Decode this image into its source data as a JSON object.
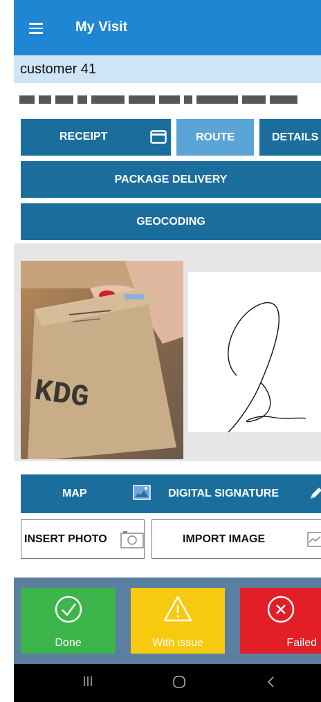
{
  "app": {
    "title": "My Visit"
  },
  "customer": {
    "name": "customer 41"
  },
  "buttons": {
    "receipt": "RECEIPT",
    "route": "ROUTE",
    "details": "DETAILS",
    "package_delivery": "PACKAGE DELIVERY",
    "geocoding": "GEOCODING",
    "map": "MAP",
    "digital_signature": "DIGITAL SIGNATURE",
    "insert_photo": "INSERT PHOTO",
    "import_image": "IMPORT IMAGE"
  },
  "photo": {
    "box_text": "KDG"
  },
  "actions": {
    "done": {
      "label": "Done",
      "color": "#3cb54a"
    },
    "issue": {
      "label": "With issue",
      "color": "#f7c90f"
    },
    "failed": {
      "label": "Failed",
      "color": "#e21e26"
    }
  },
  "colors": {
    "appbar": "#1f86d3",
    "button": "#1b6e9c",
    "button_active": "#5aa5d6",
    "customer_bar": "#cfe4f5"
  },
  "icons": [
    "menu-icon",
    "card-icon",
    "map-icon",
    "pen-icon",
    "camera-icon",
    "image-icon",
    "check-icon",
    "warning-icon",
    "close-icon",
    "recents-icon",
    "home-icon",
    "back-icon"
  ]
}
